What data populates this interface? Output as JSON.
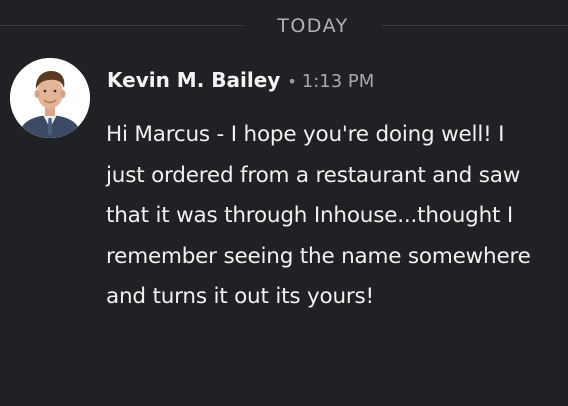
{
  "divider": {
    "label": "TODAY"
  },
  "message": {
    "author": "Kevin M. Bailey",
    "separator": "•",
    "time": "1:13 PM",
    "avatar_icon": "profile-photo-avatar",
    "text": "Hi Marcus - I hope you're doing well! I just ordered from a restaurant and saw that it was through Inhouse...thought I remember seeing the name somewhere and turns it out its yours!"
  },
  "colors": {
    "background": "#1f2124",
    "text": "#f1f1f1",
    "muted": "#a7a9ad",
    "divider_line": "#3a3c40"
  }
}
